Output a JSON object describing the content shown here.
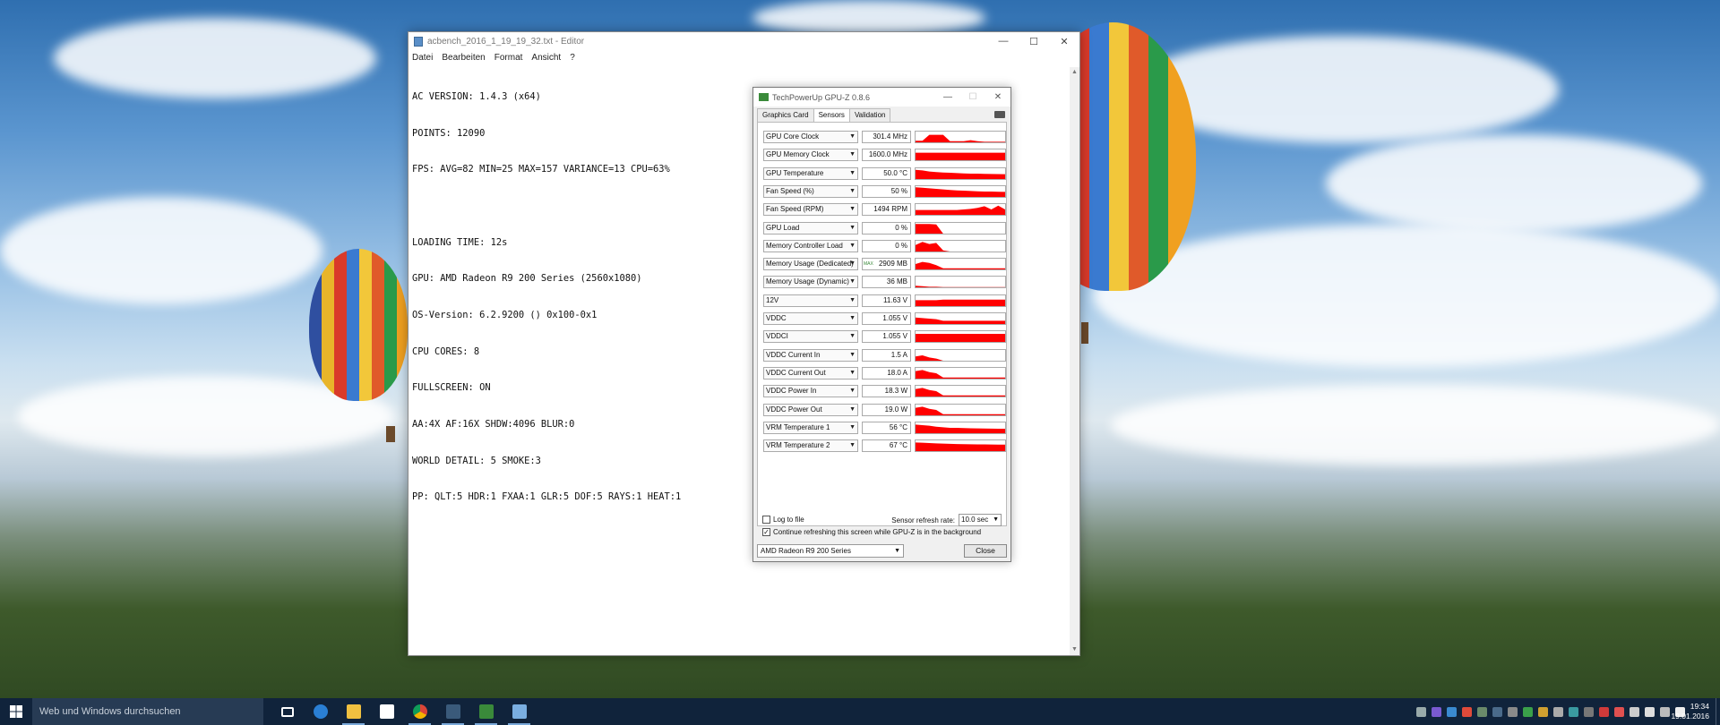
{
  "notepad": {
    "title": "acbench_2016_1_19_19_32.txt - Editor",
    "menu": [
      "Datei",
      "Bearbeiten",
      "Format",
      "Ansicht",
      "?"
    ],
    "lines": [
      "AC VERSION: 1.4.3 (x64)",
      "POINTS: 12090",
      "FPS: AVG=82 MIN=25 MAX=157 VARIANCE=13 CPU=63%",
      "",
      "LOADING TIME: 12s",
      "GPU: AMD Radeon R9 200 Series (2560x1080)",
      "OS-Version: 6.2.9200 () 0x100-0x1",
      "CPU CORES: 8",
      "FULLSCREEN: ON",
      "AA:4X AF:16X SHDW:4096 BLUR:0",
      "WORLD DETAIL: 5 SMOKE:3",
      "PP: QLT:5 HDR:1 FXAA:1 GLR:5 DOF:5 RAYS:1 HEAT:1"
    ]
  },
  "gpuz": {
    "title": "TechPowerUp GPU-Z 0.8.6",
    "tabs": [
      "Graphics Card",
      "Sensors",
      "Validation"
    ],
    "active_tab": "Sensors",
    "sensors": [
      {
        "name": "GPU Core Clock",
        "value": "301.4 MHz",
        "level": [
          0.15,
          0.15,
          0.7,
          0.7,
          0.7,
          0.1,
          0.1,
          0.1,
          0.2,
          0.1,
          0.05,
          0.05,
          0.05,
          0.05
        ]
      },
      {
        "name": "GPU Memory Clock",
        "value": "1600.0 MHz",
        "level": [
          0.7,
          0.7,
          0.7,
          0.7,
          0.7,
          0.7,
          0.7,
          0.7,
          0.7,
          0.7,
          0.7,
          0.7,
          0.7,
          0.7
        ]
      },
      {
        "name": "GPU Temperature",
        "value": "50.0 °C",
        "level": [
          0.85,
          0.8,
          0.7,
          0.65,
          0.6,
          0.58,
          0.55,
          0.52,
          0.5,
          0.5,
          0.48,
          0.47,
          0.46,
          0.45
        ]
      },
      {
        "name": "Fan Speed (%)",
        "value": "50 %",
        "level": [
          0.9,
          0.85,
          0.8,
          0.75,
          0.7,
          0.65,
          0.6,
          0.58,
          0.55,
          0.52,
          0.5,
          0.5,
          0.48,
          0.47
        ]
      },
      {
        "name": "Fan Speed (RPM)",
        "value": "1494 RPM",
        "level": [
          0.45,
          0.45,
          0.45,
          0.45,
          0.45,
          0.45,
          0.45,
          0.5,
          0.55,
          0.65,
          0.8,
          0.5,
          0.85,
          0.5
        ]
      },
      {
        "name": "GPU Load",
        "value": "0 %",
        "level": [
          0.9,
          0.9,
          0.9,
          0.85,
          0,
          0,
          0,
          0,
          0,
          0,
          0,
          0,
          0,
          0
        ]
      },
      {
        "name": "Memory Controller Load",
        "value": "0 %",
        "level": [
          0.6,
          0.9,
          0.7,
          0.8,
          0.1,
          0,
          0,
          0,
          0,
          0,
          0,
          0,
          0,
          0
        ]
      },
      {
        "name": "Memory Usage (Dedicated)",
        "value": "2909 MB",
        "mark": "MAX",
        "level": [
          0.5,
          0.7,
          0.6,
          0.4,
          0.1,
          0.1,
          0.1,
          0.1,
          0.1,
          0.1,
          0.1,
          0.1,
          0.1,
          0.1
        ]
      },
      {
        "name": "Memory Usage (Dynamic)",
        "value": "36 MB",
        "level": [
          0.15,
          0.1,
          0.05,
          0.05,
          0.02,
          0.02,
          0.02,
          0.02,
          0.02,
          0.02,
          0.02,
          0.02,
          0.02,
          0.02
        ]
      },
      {
        "name": "12V",
        "value": "11.63 V",
        "level": [
          0.55,
          0.55,
          0.55,
          0.55,
          0.6,
          0.6,
          0.6,
          0.6,
          0.6,
          0.6,
          0.6,
          0.6,
          0.6,
          0.6
        ]
      },
      {
        "name": "VDDC",
        "value": "1.055 V",
        "level": [
          0.6,
          0.55,
          0.5,
          0.45,
          0.3,
          0.3,
          0.3,
          0.3,
          0.3,
          0.3,
          0.3,
          0.3,
          0.3,
          0.3
        ]
      },
      {
        "name": "VDDCI",
        "value": "1.055 V",
        "level": [
          0.75,
          0.75,
          0.75,
          0.75,
          0.75,
          0.75,
          0.75,
          0.75,
          0.75,
          0.75,
          0.75,
          0.75,
          0.75,
          0.75
        ]
      },
      {
        "name": "VDDC Current In",
        "value": "1.5 A",
        "level": [
          0.4,
          0.5,
          0.3,
          0.2,
          0,
          0,
          0,
          0,
          0,
          0,
          0,
          0,
          0,
          0
        ]
      },
      {
        "name": "VDDC Current Out",
        "value": "18.0 A",
        "level": [
          0.7,
          0.8,
          0.6,
          0.5,
          0.1,
          0.1,
          0.1,
          0.1,
          0.1,
          0.1,
          0.1,
          0.1,
          0.1,
          0.1
        ]
      },
      {
        "name": "VDDC Power In",
        "value": "18.3 W",
        "level": [
          0.7,
          0.8,
          0.6,
          0.5,
          0.1,
          0.1,
          0.1,
          0.1,
          0.1,
          0.1,
          0.1,
          0.1,
          0.1,
          0.1
        ]
      },
      {
        "name": "VDDC Power Out",
        "value": "19.0 W",
        "level": [
          0.7,
          0.8,
          0.6,
          0.5,
          0.1,
          0.1,
          0.1,
          0.1,
          0.1,
          0.1,
          0.1,
          0.1,
          0.1,
          0.1
        ]
      },
      {
        "name": "VRM Temperature 1",
        "value": "56 °C",
        "level": [
          0.8,
          0.75,
          0.7,
          0.6,
          0.55,
          0.5,
          0.5,
          0.48,
          0.46,
          0.45,
          0.44,
          0.43,
          0.42,
          0.42
        ]
      },
      {
        "name": "VRM Temperature 2",
        "value": "67 °C",
        "level": [
          0.8,
          0.78,
          0.75,
          0.72,
          0.7,
          0.68,
          0.66,
          0.65,
          0.64,
          0.63,
          0.62,
          0.61,
          0.6,
          0.6
        ]
      }
    ],
    "graph_color": "#ff0000",
    "log_to_file": "Log to file",
    "continue_refresh": "Continue refreshing this screen while GPU-Z is in the background",
    "refresh_label": "Sensor refresh rate:",
    "refresh_value": "10.0 sec",
    "gpu_select": "AMD Radeon R9 200 Series",
    "close_label": "Close"
  },
  "taskbar": {
    "search_placeholder": "Web und Windows durchsuchen",
    "time": "19:34",
    "date": "19.01.2016"
  }
}
